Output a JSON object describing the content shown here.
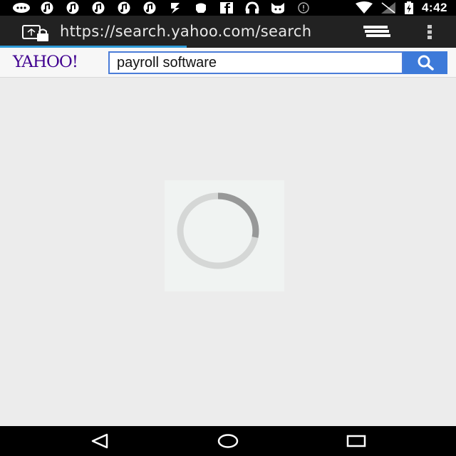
{
  "status_bar": {
    "time": "4:42",
    "left_icons": [
      "chat-bubble-icon",
      "music-note-icon",
      "music-note-icon",
      "music-note-icon",
      "music-note-icon",
      "music-note-icon",
      "transfer-icon",
      "notification-icon",
      "facebook-icon",
      "headphones-icon",
      "cat-icon",
      "alert-icon"
    ],
    "right_icons": [
      "wifi-icon",
      "signal-icon",
      "battery-charging-icon"
    ]
  },
  "browser": {
    "url": "https://search.yahoo.com/search",
    "load_progress": 0.41
  },
  "yahoo": {
    "logo": "YAHOO!",
    "search_query": "payroll software"
  },
  "colors": {
    "brand_purple": "#400090",
    "search_blue": "#3d7ad9",
    "progress_blue": "#2f9bd8"
  }
}
